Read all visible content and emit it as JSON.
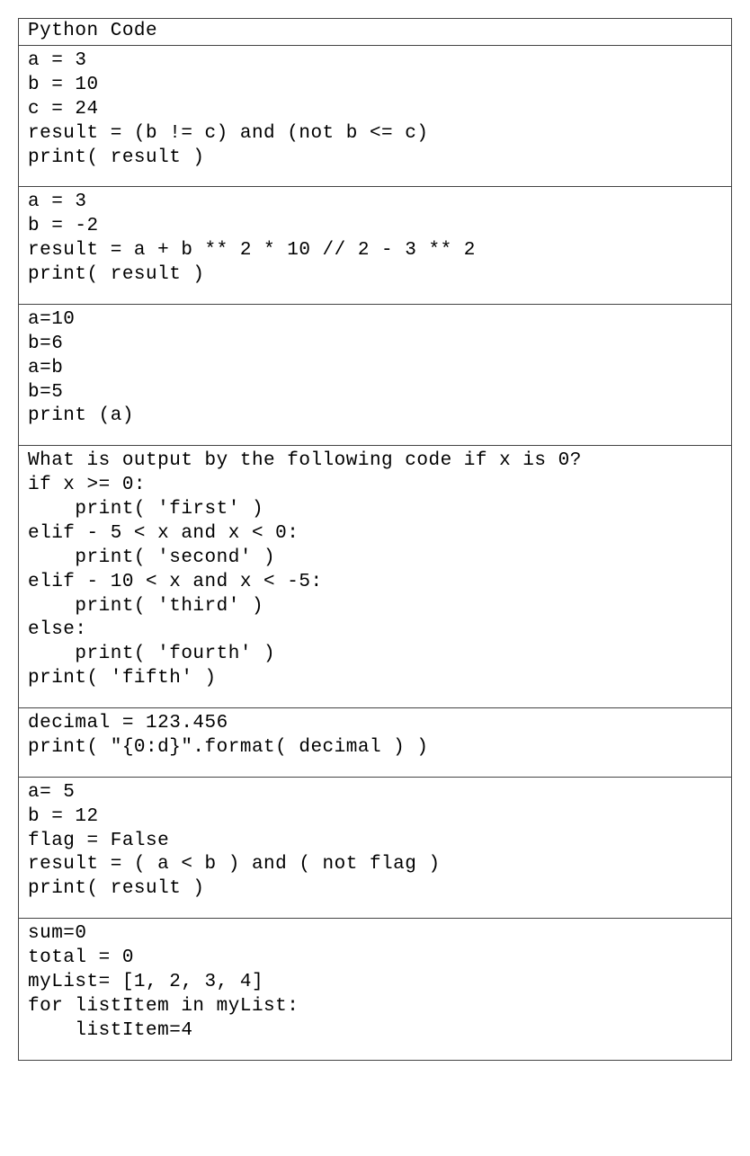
{
  "table": {
    "header": "Python Code",
    "rows": [
      "a = 3\nb = 10\nc = 24\nresult = (b != c) and (not b <= c)\nprint( result )",
      "a = 3\nb = -2\nresult = a + b ** 2 * 10 // 2 - 3 ** 2\nprint( result )",
      "a=10\nb=6\na=b\nb=5\nprint (a)",
      "What is output by the following code if x is 0?\nif x >= 0:\n    print( 'first' )\nelif - 5 < x and x < 0:\n    print( 'second' )\nelif - 10 < x and x < -5:\n    print( 'third' )\nelse:\n    print( 'fourth' )\nprint( 'fifth' )",
      "decimal = 123.456\nprint( \"{0:d}\".format( decimal ) )",
      "a= 5\nb = 12\nflag = False\nresult = ( a < b ) and ( not flag )\nprint( result )",
      "sum=0\ntotal = 0\nmyList= [1, 2, 3, 4]\nfor listItem in myList:\n    listItem=4"
    ]
  }
}
